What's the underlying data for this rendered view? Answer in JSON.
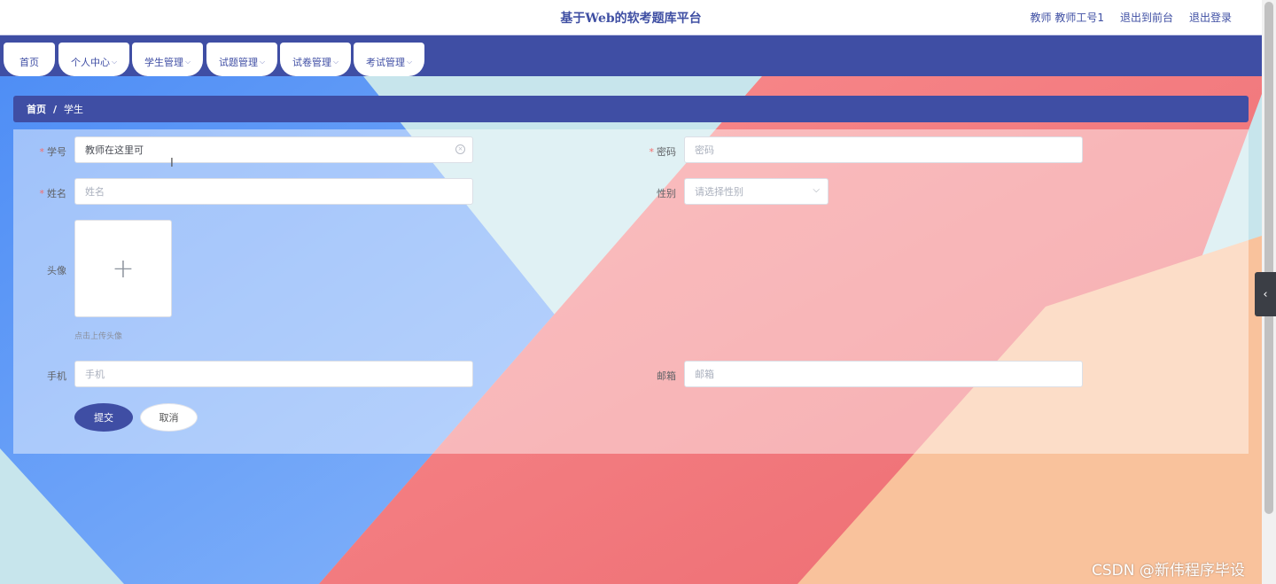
{
  "header": {
    "site_title": "基于Web的软考题库平台",
    "user_role": "教师",
    "user_name": "教师工号1",
    "front_link": "退出到前台",
    "logout_link": "退出登录"
  },
  "nav": {
    "tabs": [
      {
        "label": "首页",
        "has_dropdown": false
      },
      {
        "label": "个人中心",
        "has_dropdown": true
      },
      {
        "label": "学生管理",
        "has_dropdown": true
      },
      {
        "label": "试题管理",
        "has_dropdown": true
      },
      {
        "label": "试卷管理",
        "has_dropdown": true
      },
      {
        "label": "考试管理",
        "has_dropdown": true
      }
    ]
  },
  "breadcrumb": {
    "home": "首页",
    "separator": "/",
    "current": "学生"
  },
  "form": {
    "student_id": {
      "label": "学号",
      "value": "教师在这里可",
      "required": true
    },
    "password": {
      "label": "密码",
      "placeholder": "密码",
      "required": true
    },
    "name": {
      "label": "姓名",
      "placeholder": "姓名",
      "required": true
    },
    "gender": {
      "label": "性别",
      "placeholder": "请选择性别"
    },
    "avatar": {
      "label": "头像",
      "hint": "点击上传头像"
    },
    "phone": {
      "label": "手机",
      "placeholder": "手机"
    },
    "email": {
      "label": "邮箱",
      "placeholder": "邮箱"
    },
    "submit_label": "提交",
    "cancel_label": "取消"
  },
  "watermark": "CSDN @新伟程序毕设",
  "colors": {
    "primary": "#3f4ea4",
    "required": "#f56c6c",
    "bg_blue": "#6aa2f7",
    "bg_pink": "#f67a7e",
    "bg_peach": "#f8c29a"
  },
  "icons": {
    "clear": "circle-x-icon",
    "select_arrow": "chevron-down-icon",
    "upload": "plus-icon",
    "side_toggle": "chevron-left-icon"
  }
}
